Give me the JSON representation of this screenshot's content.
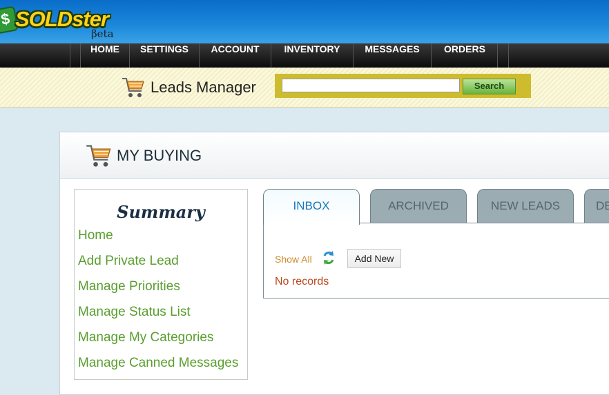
{
  "brand": {
    "logo_text": "SOLDster",
    "tagline": "βeta",
    "colors": {
      "header_blue": "#0a6dc9",
      "logo_yellow": "#ffd21a",
      "link_green": "#5a9e2f"
    }
  },
  "nav": {
    "items": [
      "HOME",
      "SETTINGS",
      "ACCOUNT",
      "INVENTORY",
      "MESSAGES",
      "ORDERS"
    ]
  },
  "leads_manager": {
    "icon": "shopping-cart-icon",
    "title": "Leads Manager"
  },
  "search": {
    "placeholder": "",
    "button_label": "Search"
  },
  "panel": {
    "icon": "shopping-cart-icon",
    "title": "MY BUYING"
  },
  "summary": {
    "title": "Summary",
    "links": [
      "Home",
      "Add Private Lead",
      "Manage Priorities",
      "Manage Status List",
      "Manage My Categories",
      "Manage Canned Messages"
    ]
  },
  "tabs": {
    "items": [
      "INBOX",
      "ARCHIVED",
      "NEW LEADS",
      "DE"
    ],
    "active": "INBOX"
  },
  "inbox": {
    "show_all": "Show All",
    "refresh_icon": "refresh-icon",
    "add_new": "Add New",
    "empty_message": "No records"
  }
}
